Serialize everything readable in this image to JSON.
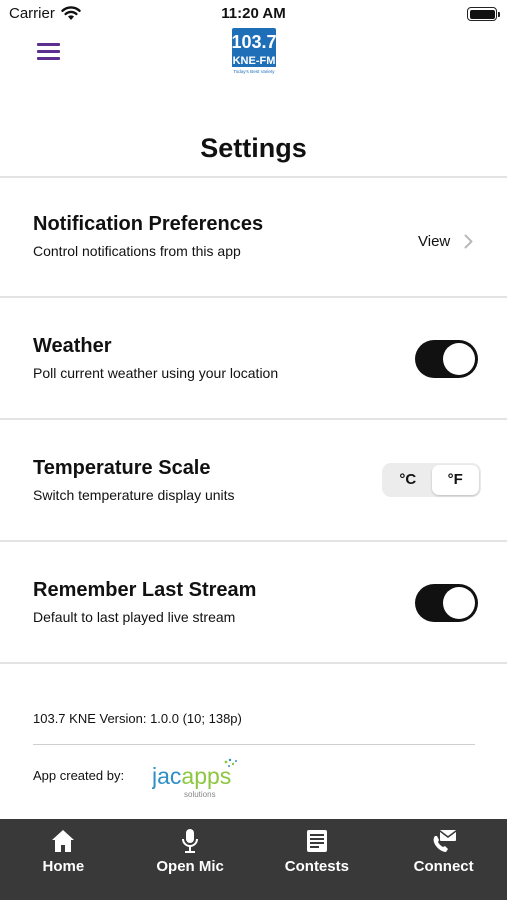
{
  "status_bar": {
    "carrier": "Carrier",
    "time": "11:20 AM"
  },
  "header": {
    "logo": {
      "name": "103.7 KNE-FM logo",
      "line1": "103.7",
      "line2": "KNE-FM",
      "tagline": "Today's Best Variety"
    }
  },
  "page": {
    "title": "Settings"
  },
  "settings": {
    "notifications": {
      "title": "Notification Preferences",
      "subtitle": "Control notifications from this app",
      "action_label": "View"
    },
    "weather": {
      "title": "Weather",
      "subtitle": "Poll current weather using your location",
      "enabled": true
    },
    "temperature": {
      "title": "Temperature Scale",
      "subtitle": "Switch temperature display units",
      "options": [
        "°C",
        "°F"
      ],
      "selected": "°F"
    },
    "last_stream": {
      "title": "Remember Last Stream",
      "subtitle": "Default to last played live stream",
      "enabled": true
    }
  },
  "footer_info": {
    "version": "103.7 KNE Version: 1.0.0 (10; 138p)",
    "credit_label": "App created by:",
    "maker_logo": {
      "brand": "jacapps",
      "sub": "solutions"
    }
  },
  "tabbar": {
    "items": [
      {
        "label": "Home",
        "icon": "home-icon"
      },
      {
        "label": "Open Mic",
        "icon": "microphone-icon"
      },
      {
        "label": "Contests",
        "icon": "newspaper-icon"
      },
      {
        "label": "Connect",
        "icon": "contact-icon"
      }
    ]
  },
  "colors": {
    "menu_accent": "#5c2f8f",
    "logo_blue": "#1f6fb8",
    "toggle_on": "#111111",
    "tabbar_bg": "#393939",
    "jacapps_blue": "#2f8fc4",
    "jacapps_green": "#8dc63f"
  }
}
